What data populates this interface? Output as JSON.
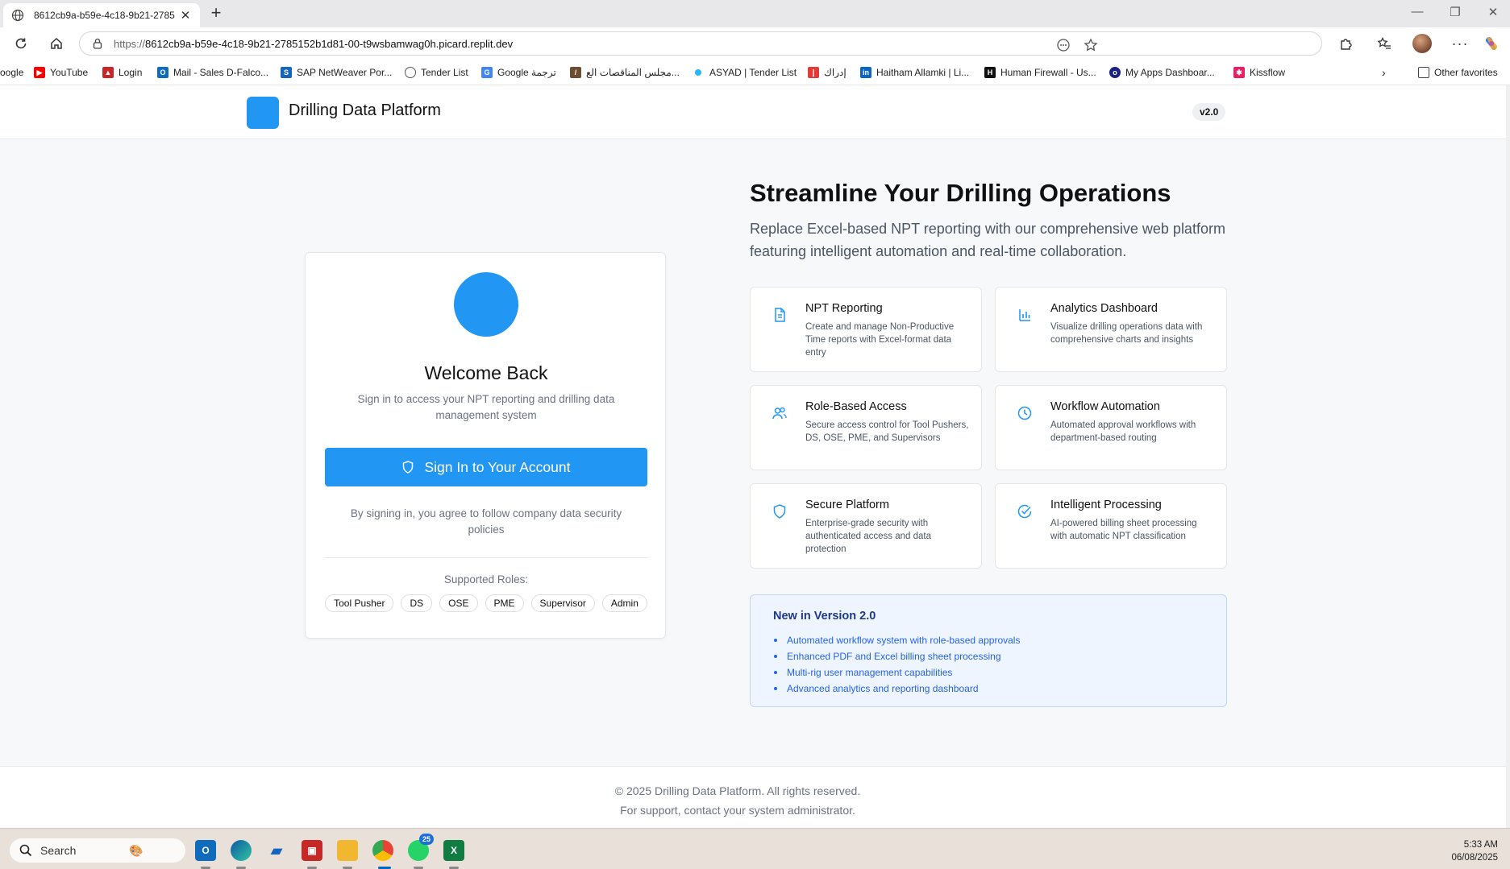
{
  "browser": {
    "tab_title": "8612cb9a-b59e-4c18-9b21-2785",
    "url_prefix": "https://",
    "url_host": "8612cb9a-b59e-4c18-9b21-2785152b1d81-00-t9wsbamwag0h.picard.replit.dev",
    "bookmarks": [
      {
        "label": "oogle",
        "icon": "google-icon",
        "color": "#4285f4"
      },
      {
        "label": "YouTube",
        "icon": "youtube-icon",
        "color": "#ff0000"
      },
      {
        "label": "Login",
        "icon": "login-icon",
        "color": "#c62828"
      },
      {
        "label": "Mail - Sales D-Falco...",
        "icon": "outlook-icon",
        "color": "#0f6cbd"
      },
      {
        "label": "SAP NetWeaver Por...",
        "icon": "sap-icon",
        "color": "#1565c0"
      },
      {
        "label": "Tender List",
        "icon": "globe-icon",
        "color": "#555555"
      },
      {
        "label": "Google ترجمة",
        "icon": "translate-icon",
        "color": "#4285f4"
      },
      {
        "label": "مجلس المناقصات الع...",
        "icon": "tender-board-icon",
        "color": "#6d4c2f"
      },
      {
        "label": "ASYAD | Tender List",
        "icon": "asyad-icon",
        "color": "#29b6f6"
      },
      {
        "label": "إدراك",
        "icon": "edraak-icon",
        "color": "#e53935"
      },
      {
        "label": "Haitham Allamki | Li...",
        "icon": "linkedin-icon",
        "color": "#0a66c2"
      },
      {
        "label": "Human Firewall - Us...",
        "icon": "human-firewall-icon",
        "color": "#111111"
      },
      {
        "label": "My Apps Dashboar...",
        "icon": "okta-icon",
        "color": "#1a237e"
      },
      {
        "label": "Kissflow",
        "icon": "kissflow-icon",
        "color": "#e91e63"
      }
    ],
    "other_favorites": "Other favorites"
  },
  "header": {
    "brand": "Drilling Data Platform",
    "version": "v2.0"
  },
  "login": {
    "title": "Welcome Back",
    "subtitle": "Sign in to access your NPT reporting and drilling data management system",
    "button": "Sign In to Your Account",
    "agreement": "By signing in, you agree to follow company data security policies",
    "roles_title": "Supported Roles:",
    "roles": [
      "Tool Pusher",
      "DS",
      "OSE",
      "PME",
      "Supervisor",
      "Admin"
    ]
  },
  "hero": {
    "title": "Streamline Your Drilling Operations",
    "subtitle": "Replace Excel-based NPT reporting with our comprehensive web platform featuring intelligent automation and real-time collaboration."
  },
  "features": [
    {
      "title": "NPT Reporting",
      "desc": "Create and manage Non-Productive Time reports with Excel-format data entry",
      "icon": "document-icon"
    },
    {
      "title": "Analytics Dashboard",
      "desc": "Visualize drilling operations data with comprehensive charts and insights",
      "icon": "bar-chart-icon"
    },
    {
      "title": "Role-Based Access",
      "desc": "Secure access control for Tool Pushers, DS, OSE, PME, and Supervisors",
      "icon": "users-icon"
    },
    {
      "title": "Workflow Automation",
      "desc": "Automated approval workflows with department-based routing",
      "icon": "clock-icon"
    },
    {
      "title": "Secure Platform",
      "desc": "Enterprise-grade security with authenticated access and data protection",
      "icon": "shield-icon"
    },
    {
      "title": "Intelligent Processing",
      "desc": "AI-powered billing sheet processing with automatic NPT classification",
      "icon": "check-circle-icon"
    }
  ],
  "whats_new": {
    "title": "New in Version 2.0",
    "items": [
      "Automated workflow system with role-based approvals",
      "Enhanced PDF and Excel billing sheet processing",
      "Multi-rig user management capabilities",
      "Advanced analytics and reporting dashboard"
    ]
  },
  "footer": {
    "copyright": "© 2025 Drilling Data Platform. All rights reserved.",
    "support": "For support, contact your system administrator."
  },
  "taskbar": {
    "search_placeholder": "Search",
    "whatsapp_badge": "25",
    "time": "5:33 AM",
    "date": "06/08/2025"
  },
  "colors": {
    "accent": "#2196f3",
    "news_bg": "#eef5fe",
    "news_text": "#2563eb"
  }
}
